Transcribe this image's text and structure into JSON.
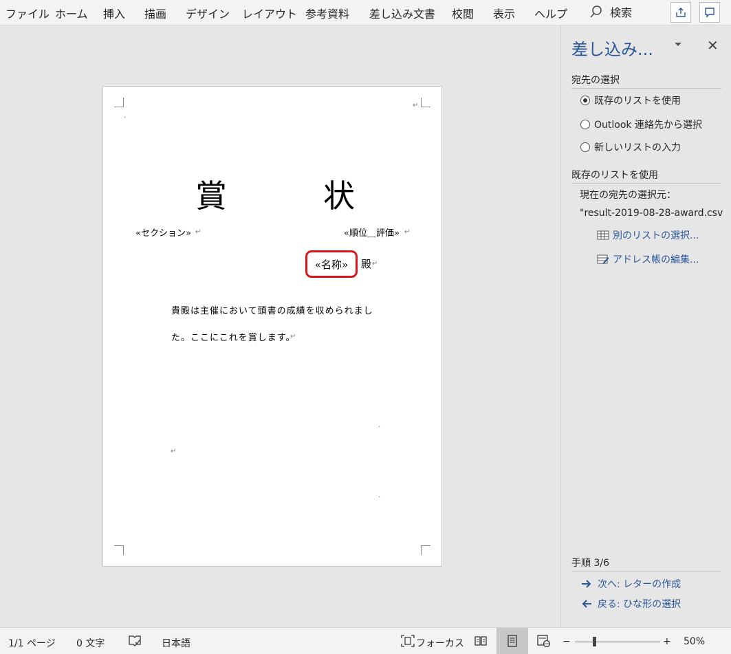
{
  "menubar": {
    "tabs": [
      "ファイル",
      "ホーム",
      "挿入",
      "描画",
      "デザイン",
      "レイアウト",
      "参考資料",
      "差し込み文書",
      "校閲",
      "表示",
      "ヘルプ"
    ],
    "search_label": "検索"
  },
  "document": {
    "title_left": "賞",
    "title_right": "状",
    "field_section": "«セクション»",
    "field_rank": "«順位＿評価»",
    "field_name": "«名称»",
    "honorific": "殿",
    "body_line1": "貴殿は主催において頭書の成績を収められまし",
    "body_line2": "た。ここにこれを賞します。"
  },
  "pane": {
    "title": "差し込み...",
    "section_recipients": "宛先の選択",
    "options": [
      "既存のリストを使用",
      "Outlook 連絡先から選択",
      "新しいリストの入力"
    ],
    "selected_option": 0,
    "section_existing": "既存のリストを使用",
    "current_source_label": "現在の宛先の選択元：",
    "current_source_value": "\"result-2019-08-28-award.csv",
    "link_other_list": "別のリストの選択...",
    "link_edit_address": "アドレス帳の編集...",
    "step_label": "手順 3/6",
    "next_link": "次へ: レターの作成",
    "back_link": "戻る: ひな形の選択"
  },
  "status": {
    "page": "1/1 ページ",
    "words": "0 文字",
    "language": "日本語",
    "focus": "フォーカス",
    "zoom_minus": "−",
    "zoom_plus": "+",
    "zoom_level": "50%"
  },
  "colors": {
    "accent": "#2b579a",
    "highlight": "#e0151b"
  }
}
